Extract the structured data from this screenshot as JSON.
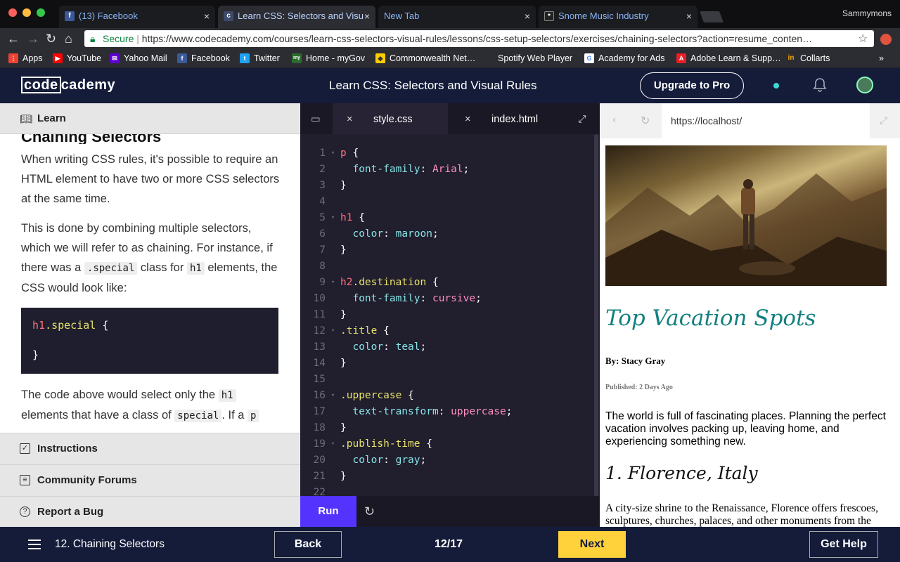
{
  "browser": {
    "tabs": [
      {
        "title": "(13) Facebook",
        "fav": "f",
        "fav_color": "#3b5998"
      },
      {
        "title": "Learn CSS: Selectors and Visu",
        "fav": "c",
        "fav_color": "#3d4a6b"
      },
      {
        "title": "New Tab",
        "fav": "",
        "fav_color": "#2c2d33"
      },
      {
        "title": "Snome Music Industry",
        "fav": "*",
        "fav_color": "#222"
      }
    ],
    "profile_name": "Sammymons",
    "secure_label": "Secure",
    "url": "https://www.codecademy.com/courses/learn-css-selectors-visual-rules/lessons/css-setup-selectors/exercises/chaining-selectors?action=resume_conten…",
    "bookmarks": [
      {
        "label": "Apps",
        "color": "#ea4335",
        "glyph": "⋮"
      },
      {
        "label": "YouTube",
        "color": "#ff0000",
        "glyph": "▶"
      },
      {
        "label": "Yahoo Mail",
        "color": "#6001d2",
        "glyph": "✉"
      },
      {
        "label": "Facebook",
        "color": "#3b5998",
        "glyph": "f"
      },
      {
        "label": "Twitter",
        "color": "#1da1f2",
        "glyph": "t"
      },
      {
        "label": "Home - myGov",
        "color": "#2d6a2d",
        "glyph": "my"
      },
      {
        "label": "Commonwealth Net…",
        "color": "#ffcc00",
        "glyph": "◆"
      },
      {
        "label": "Spotify Web Player",
        "color": "#2c2d33",
        "glyph": ""
      },
      {
        "label": "Academy for Ads",
        "color": "#ffffff",
        "glyph": "G"
      },
      {
        "label": "Adobe Learn & Supp…",
        "color": "#ec1c24",
        "glyph": "A"
      },
      {
        "label": "Collarts",
        "color": "#f6a400",
        "glyph": "in"
      }
    ]
  },
  "header": {
    "logo_box": "code",
    "logo_rest": "cademy",
    "course_title": "Learn CSS: Selectors and Visual Rules",
    "upgrade_label": "Upgrade to Pro"
  },
  "lesson": {
    "panel_label": "Learn",
    "heading": "Chaining Selectors",
    "p1": "When writing CSS rules, it's possible to require an HTML element to have two or more CSS selectors at the same time.",
    "p2_a": "This is done by combining multiple selectors, which we will refer to as chaining. For instance, if there was a ",
    "p2_code1": ".special",
    "p2_b": " class for ",
    "p2_code2": "h1",
    "p2_c": " elements, the CSS would look like:",
    "code_sel": "h1",
    "code_cls": ".special",
    "code_open": "{",
    "code_close": "}",
    "p3_a": "The code above would select only the ",
    "p3_code1": "h1",
    "p3_b": " elements that have a class of ",
    "p3_code2": "special",
    "p3_c": ". If a ",
    "p3_code3": "p",
    "accordion": [
      {
        "label": "Instructions",
        "glyph": "✓"
      },
      {
        "label": "Community Forums",
        "glyph": "≡"
      },
      {
        "label": "Report a Bug",
        "glyph": "?"
      }
    ]
  },
  "editor": {
    "tabs": [
      {
        "label": "style.css",
        "close": "×"
      },
      {
        "label": "index.html",
        "close": "×"
      }
    ],
    "folder_glyph": "▭",
    "expand_glyph": "⤢",
    "code_lines": [
      {
        "n": "1",
        "fold": "▾",
        "parts": [
          [
            "k-sel",
            "p"
          ],
          [
            "k-pun",
            " {"
          ]
        ]
      },
      {
        "n": "2",
        "fold": "",
        "parts": [
          [
            "k-pun",
            "  "
          ],
          [
            "k-prop",
            "font-family"
          ],
          [
            "k-pun",
            ": "
          ],
          [
            "k-val",
            "Arial"
          ],
          [
            "k-pun",
            ";"
          ]
        ]
      },
      {
        "n": "3",
        "fold": "",
        "parts": [
          [
            "k-pun",
            "}"
          ]
        ]
      },
      {
        "n": "4",
        "fold": "",
        "parts": []
      },
      {
        "n": "5",
        "fold": "▾",
        "parts": [
          [
            "k-sel",
            "h1"
          ],
          [
            "k-pun",
            " {"
          ]
        ]
      },
      {
        "n": "6",
        "fold": "",
        "parts": [
          [
            "k-pun",
            "  "
          ],
          [
            "k-prop",
            "color"
          ],
          [
            "k-pun",
            ": "
          ],
          [
            "k-prop",
            "maroon"
          ],
          [
            "k-pun",
            ";"
          ]
        ]
      },
      {
        "n": "7",
        "fold": "",
        "parts": [
          [
            "k-pun",
            "}"
          ]
        ]
      },
      {
        "n": "8",
        "fold": "",
        "parts": []
      },
      {
        "n": "9",
        "fold": "▾",
        "parts": [
          [
            "k-sel",
            "h2"
          ],
          [
            "k-cls",
            ".destination"
          ],
          [
            "k-pun",
            " {"
          ]
        ]
      },
      {
        "n": "10",
        "fold": "",
        "parts": [
          [
            "k-pun",
            "  "
          ],
          [
            "k-prop",
            "font-family"
          ],
          [
            "k-pun",
            ": "
          ],
          [
            "k-val",
            "cursive"
          ],
          [
            "k-pun",
            ";"
          ]
        ]
      },
      {
        "n": "11",
        "fold": "",
        "parts": [
          [
            "k-pun",
            "}"
          ]
        ]
      },
      {
        "n": "12",
        "fold": "▾",
        "parts": [
          [
            "k-cls",
            ".title"
          ],
          [
            "k-pun",
            " {"
          ]
        ]
      },
      {
        "n": "13",
        "fold": "",
        "parts": [
          [
            "k-pun",
            "  "
          ],
          [
            "k-prop",
            "color"
          ],
          [
            "k-pun",
            ": "
          ],
          [
            "k-prop",
            "teal"
          ],
          [
            "k-pun",
            ";"
          ]
        ]
      },
      {
        "n": "14",
        "fold": "",
        "parts": [
          [
            "k-pun",
            "}"
          ]
        ]
      },
      {
        "n": "15",
        "fold": "",
        "parts": []
      },
      {
        "n": "16",
        "fold": "▾",
        "parts": [
          [
            "k-cls",
            ".uppercase"
          ],
          [
            "k-pun",
            " {"
          ]
        ]
      },
      {
        "n": "17",
        "fold": "",
        "parts": [
          [
            "k-pun",
            "  "
          ],
          [
            "k-prop",
            "text-transform"
          ],
          [
            "k-pun",
            ": "
          ],
          [
            "k-val",
            "uppercase"
          ],
          [
            "k-pun",
            ";"
          ]
        ]
      },
      {
        "n": "18",
        "fold": "",
        "parts": [
          [
            "k-pun",
            "}"
          ]
        ]
      },
      {
        "n": "19",
        "fold": "▾",
        "parts": [
          [
            "k-cls",
            ".publish-time"
          ],
          [
            "k-pun",
            " {"
          ]
        ]
      },
      {
        "n": "20",
        "fold": "",
        "parts": [
          [
            "k-pun",
            "  "
          ],
          [
            "k-prop",
            "color"
          ],
          [
            "k-pun",
            ": "
          ],
          [
            "k-prop",
            "gray"
          ],
          [
            "k-pun",
            ";"
          ]
        ]
      },
      {
        "n": "21",
        "fold": "",
        "parts": [
          [
            "k-pun",
            "}"
          ]
        ]
      },
      {
        "n": "22",
        "fold": "",
        "parts": []
      }
    ],
    "run_label": "Run",
    "reset_glyph": "↻"
  },
  "preview": {
    "url": "https://localhost/",
    "title": "Top Vacation Spots",
    "byline": "By: Stacy Gray",
    "published": "Published: 2 Days Ago",
    "intro": "The world is full of fascinating places. Planning the perfect vacation involves packing up, leaving home, and experiencing something new.",
    "dest1": "1. Florence, Italy",
    "dest1_desc": "A city-size shrine to the Renaissance, Florence offers frescoes, sculptures, churches, palaces, and other monuments from the"
  },
  "footer": {
    "exercise": "12. Chaining Selectors",
    "back_label": "Back",
    "progress": "12/17",
    "next_label": "Next",
    "help_label": "Get Help"
  }
}
